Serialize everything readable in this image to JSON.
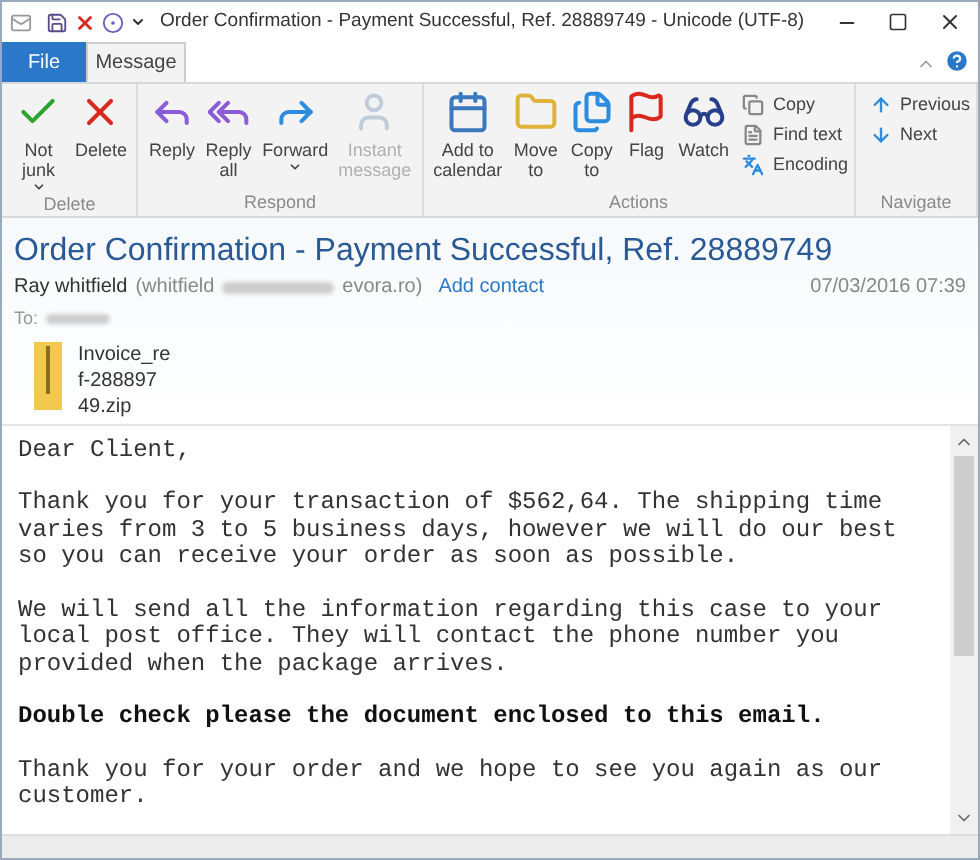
{
  "window": {
    "title": "Order Confirmation - Payment Successful, Ref.  28889749 - Unicode (UTF-8)"
  },
  "tabs": [
    {
      "label": "File",
      "kind": "file",
      "selected": false
    },
    {
      "label": "Message",
      "kind": "tab",
      "selected": true
    }
  ],
  "ribbon": {
    "groups": [
      {
        "label": "Delete",
        "buttons": [
          {
            "label": "Not junk",
            "dropdown": true,
            "disabled": false
          },
          {
            "label": "Delete",
            "dropdown": false,
            "disabled": false
          }
        ]
      },
      {
        "label": "Respond",
        "buttons": [
          {
            "label": "Reply",
            "dropdown": false,
            "disabled": false
          },
          {
            "label": "Reply all",
            "dropdown": false,
            "disabled": false
          },
          {
            "label": "Forward",
            "dropdown": true,
            "disabled": false
          },
          {
            "label": "Instant message",
            "dropdown": false,
            "disabled": true
          }
        ]
      },
      {
        "label": "Actions",
        "buttons": [
          {
            "label": "Add to calendar",
            "dropdown": false,
            "disabled": false
          },
          {
            "label": "Move to",
            "dropdown": false,
            "disabled": false
          },
          {
            "label": "Copy to",
            "dropdown": false,
            "disabled": false
          },
          {
            "label": "Flag",
            "dropdown": false,
            "disabled": false
          },
          {
            "label": "Watch",
            "dropdown": false,
            "disabled": false
          }
        ],
        "small": [
          {
            "label": "Copy"
          },
          {
            "label": "Find text"
          },
          {
            "label": "Encoding"
          }
        ]
      },
      {
        "label": "Navigate",
        "small": [
          {
            "label": "Previous"
          },
          {
            "label": "Next"
          }
        ]
      }
    ]
  },
  "message": {
    "subject": "Order Confirmation - Payment Successful, Ref.  28889749",
    "sender_name": "Ray whitfield",
    "sender_email_start": "(whitfield",
    "sender_email_end": "evora.ro)",
    "add_contact": "Add contact",
    "date": "07/03/2016 07:39",
    "to_label": "To:",
    "attachment": {
      "name_lines": [
        "Invoice_re",
        "f-288897",
        "49.zip"
      ]
    },
    "body": [
      {
        "kind": "normal",
        "text": "Dear Client,"
      },
      {
        "kind": "normal",
        "text": "Thank you for your transaction of $562,64. The shipping time\nvaries from 3 to 5 business days, however we will do our best\nso you can receive your order as soon as possible."
      },
      {
        "kind": "normal",
        "text": "We will send all the information regarding this case to your\nlocal post office. They will contact the phone number you\nprovided when the package arrives."
      },
      {
        "kind": "bold",
        "text": "Double check please the document enclosed to this email."
      },
      {
        "kind": "normal",
        "text": "Thank you for your order and we hope to see you again as our\ncustomer."
      }
    ]
  }
}
